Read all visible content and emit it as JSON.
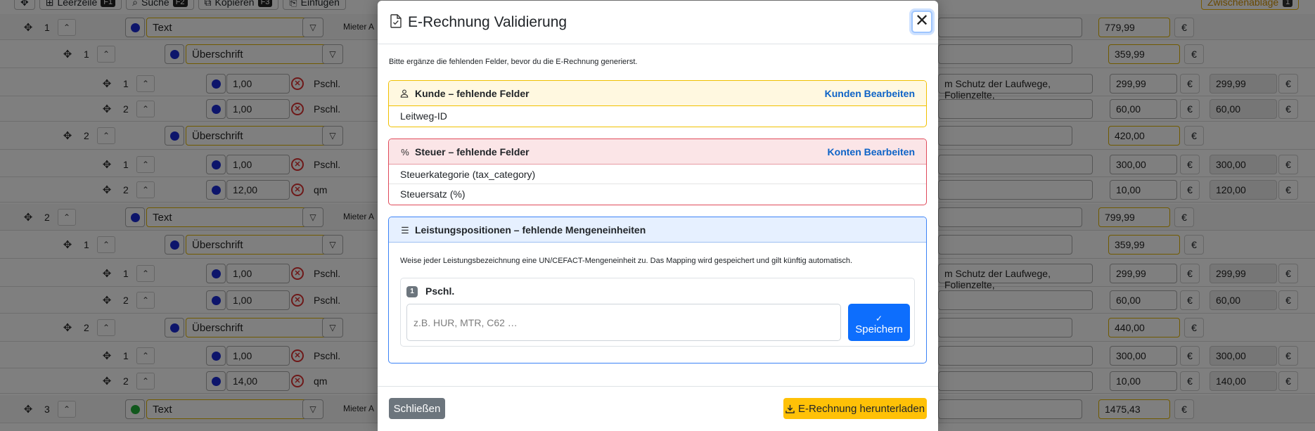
{
  "toolbar": {
    "buttons": [
      {
        "label": "Leerzeile",
        "key": "F1"
      },
      {
        "label": "Suche",
        "key": "F2"
      },
      {
        "label": "Kopieren",
        "key": "F3"
      },
      {
        "label": "Einfügen",
        "key": ""
      }
    ],
    "clipboard_label": "Zwischenablage",
    "clipboard_count": "1"
  },
  "editor_rows": [
    {
      "level": 0,
      "pos": "1",
      "type": "Text",
      "mieter": "Mieter A",
      "price": "779,99",
      "dot": "blue"
    },
    {
      "level": 1,
      "pos": "1",
      "type": "Überschrift",
      "price": "359,99"
    },
    {
      "level": 2,
      "pos": "1",
      "qty": "1,00",
      "unit": "Pschl.",
      "desc": "m Schutz der Laufwege, Folienzelte,",
      "price": "299,99",
      "total": "299,99"
    },
    {
      "level": 2,
      "pos": "2",
      "qty": "1,00",
      "unit": "Pschl.",
      "desc": "",
      "price": "60,00",
      "total": "60,00"
    },
    {
      "level": 1,
      "pos": "2",
      "type": "Überschrift",
      "price": "420,00"
    },
    {
      "level": 2,
      "pos": "1",
      "qty": "1,00",
      "unit": "Pschl.",
      "desc": "",
      "price": "300,00",
      "total": "300,00"
    },
    {
      "level": 2,
      "pos": "2",
      "qty": "12,00",
      "unit": "qm",
      "desc": "",
      "price": "10,00",
      "total": "120,00"
    },
    {
      "level": 0,
      "pos": "2",
      "type": "Text",
      "mieter": "Mieter A",
      "price": "799,99",
      "dot": "blue"
    },
    {
      "level": 1,
      "pos": "1",
      "type": "Überschrift",
      "price": "359,99"
    },
    {
      "level": 2,
      "pos": "1",
      "qty": "1,00",
      "unit": "Pschl.",
      "desc": "m Schutz der Laufwege, Folienzelte,",
      "price": "299,99",
      "total": "299,99"
    },
    {
      "level": 2,
      "pos": "2",
      "qty": "1,00",
      "unit": "Pschl.",
      "desc": "",
      "price": "60,00",
      "total": "60,00"
    },
    {
      "level": 1,
      "pos": "2",
      "type": "Überschrift",
      "price": "440,00"
    },
    {
      "level": 2,
      "pos": "1",
      "qty": "1,00",
      "unit": "Pschl.",
      "desc": "",
      "price": "300,00",
      "total": "300,00"
    },
    {
      "level": 2,
      "pos": "2",
      "qty": "14,00",
      "unit": "qm",
      "desc": "",
      "price": "10,00",
      "total": "140,00"
    },
    {
      "level": 0,
      "pos": "3",
      "type": "Text",
      "mieter": "Mieter A",
      "price": "1475,43",
      "dot": "green"
    }
  ],
  "currency": "€",
  "modal": {
    "title": "E-Rechnung Validierung",
    "intro": "Bitte ergänze die fehlenden Felder, bevor du die E-Rechnung generierst.",
    "customer": {
      "title": "Kunde – fehlende Felder",
      "action": "Kunden Bearbeiten",
      "items": [
        "Leitweg-ID"
      ]
    },
    "tax": {
      "title": "Steuer – fehlende Felder",
      "action": "Konten Bearbeiten",
      "items": [
        "Steuerkategorie (tax_category)",
        "Steuersatz (%)"
      ]
    },
    "positions": {
      "title": "Leistungspositionen – fehlende Mengeneinheiten",
      "description": "Weise jeder Leistungsbezeichnung eine UN/CEFACT-Mengeneinheit zu. Das Mapping wird gespeichert und gilt künftig automatisch.",
      "entries": [
        {
          "index": "1",
          "label": "Pschl.",
          "placeholder": "z.B. HUR, MTR, C62 …",
          "save_label": "Speichern"
        }
      ]
    },
    "close_label": "Schließen",
    "download_label": "E-Rechnung herunterladen"
  },
  "colors": {
    "primary": "#0d6efd",
    "warning": "#ffc107",
    "danger": "#e04a5a",
    "secondary": "#6c757d"
  }
}
